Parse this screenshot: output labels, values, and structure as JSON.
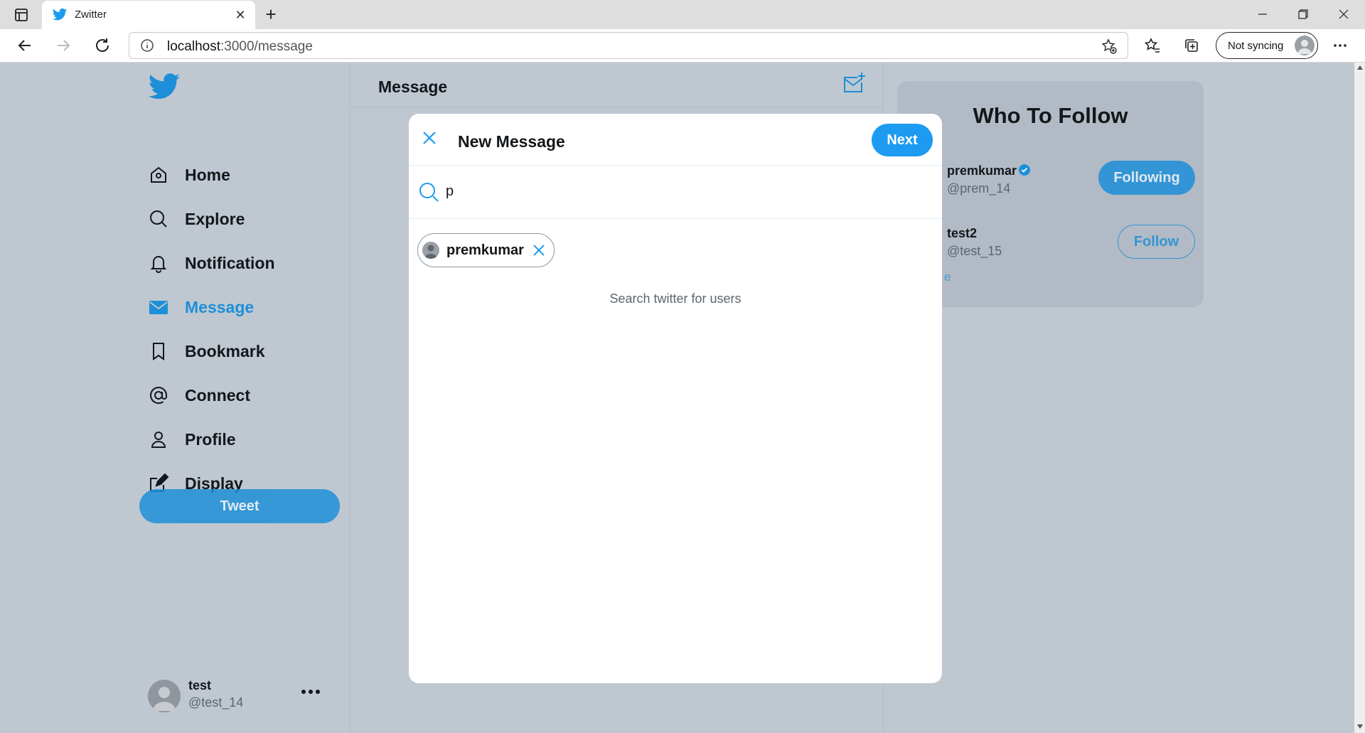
{
  "browser": {
    "tab_title": "Zwitter",
    "url_host": "localhost",
    "url_path": ":3000/message",
    "sync_label": "Not syncing"
  },
  "sidebar": {
    "items": [
      {
        "label": "Home",
        "icon": "home-icon"
      },
      {
        "label": "Explore",
        "icon": "search-icon"
      },
      {
        "label": "Notification",
        "icon": "bell-icon"
      },
      {
        "label": "Message",
        "icon": "mail-icon",
        "active": true
      },
      {
        "label": "Bookmark",
        "icon": "bookmark-icon"
      },
      {
        "label": "Connect",
        "icon": "at-icon"
      },
      {
        "label": "Profile",
        "icon": "person-icon"
      },
      {
        "label": "Display",
        "icon": "edit-icon"
      }
    ],
    "tweet_label": "Tweet",
    "user": {
      "name": "test",
      "handle": "@test_14"
    }
  },
  "main": {
    "title": "Message"
  },
  "who_to_follow": {
    "title": "Who To Follow",
    "users": [
      {
        "name": "premkumar",
        "handle": "@prem_14",
        "verified": true,
        "button": "Following"
      },
      {
        "name": "test2",
        "handle": "@test_15",
        "verified": false,
        "button": "Follow"
      }
    ],
    "partial_text": "e"
  },
  "modal": {
    "title": "New Message",
    "next_label": "Next",
    "search_value": "p",
    "selected_chip": "premkumar",
    "hint": "Search twitter for users"
  },
  "colors": {
    "accent": "#1d9bf0",
    "overlay": "#bfc7d0"
  }
}
